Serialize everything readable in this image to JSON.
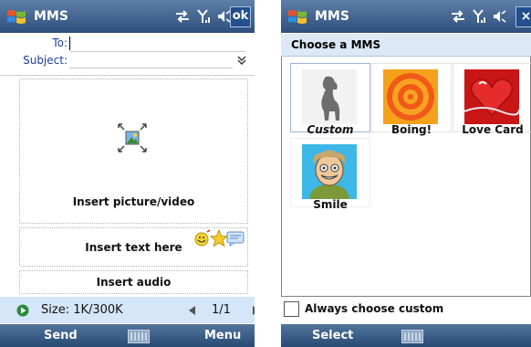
{
  "left": {
    "title": "MMS",
    "ok_label": "ok",
    "to_label": "To:",
    "subject_label": "Subject:",
    "insert_picture_label": "Insert picture/video",
    "insert_text_label": "Insert text here",
    "insert_audio_label": "Insert audio",
    "size_text": "Size: 1K/300K",
    "page_text": "1/1",
    "softkey_left": "Send",
    "softkey_right": "Menu"
  },
  "right": {
    "title": "MMS",
    "close_label": "×",
    "header": "Choose a MMS",
    "templates": [
      {
        "label": "Custom",
        "icon": "dog-silhouette-icon"
      },
      {
        "label": "Boing!",
        "icon": "concentric-circles-icon"
      },
      {
        "label": "Love Card",
        "icon": "heart-icon"
      },
      {
        "label": "Smile",
        "icon": "smiling-face-icon"
      }
    ],
    "always_custom_label": "Always choose custom",
    "softkey_left": "Select"
  },
  "colors": {
    "titlebar": "#2e4f7c",
    "status_bar": "#d4e6f7",
    "label_blue": "#1c3f9b",
    "softkey_bar": "#284a74"
  }
}
